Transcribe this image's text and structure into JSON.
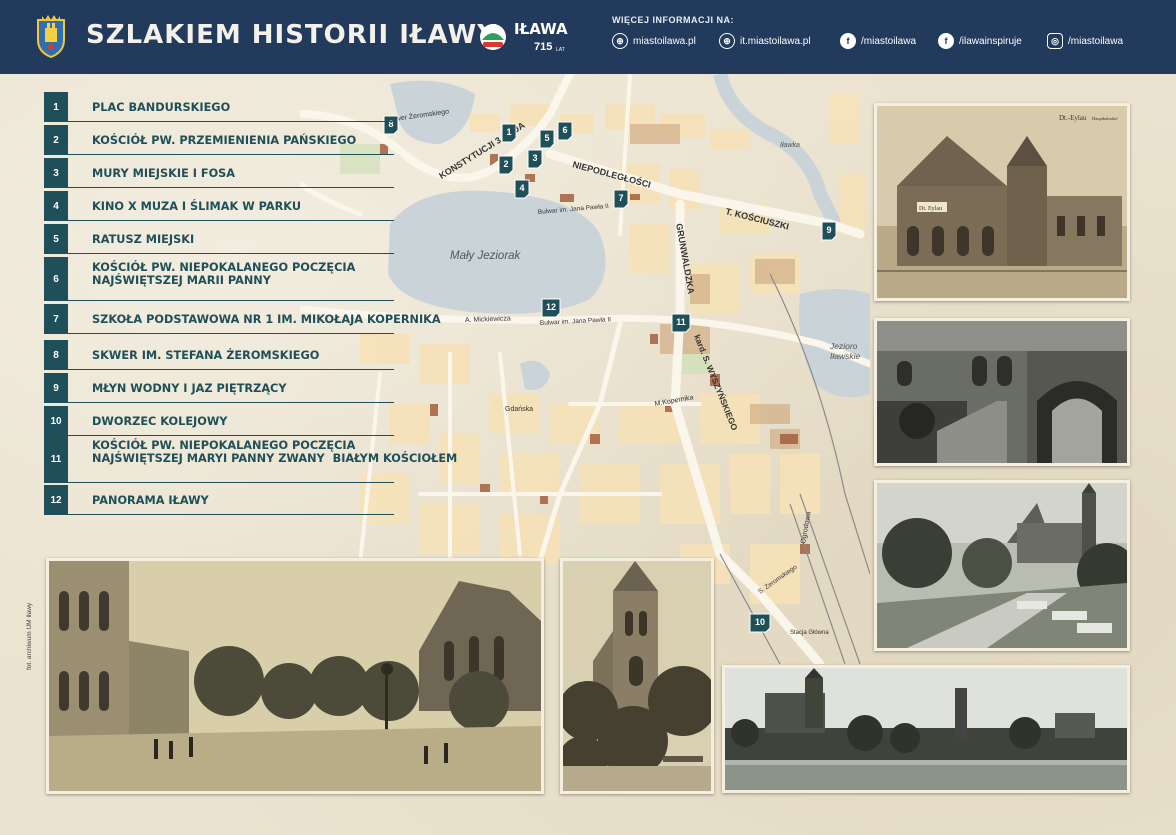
{
  "header": {
    "title": "SZLAKIEM HISTORII IŁAWY",
    "logo_text": "IŁAWA",
    "logo_years": "715",
    "logo_years_suffix": "LAT",
    "info_label": "WIĘCEJ INFORMACJI NA:",
    "links": [
      {
        "icon": "globe-icon",
        "text": "miastoilawa.pl"
      },
      {
        "icon": "globe-icon",
        "text": "it.miastoilawa.pl"
      },
      {
        "icon": "facebook-icon",
        "text": "/miastoilawa"
      },
      {
        "icon": "facebook-icon",
        "text": "/ilawainspiruje"
      },
      {
        "icon": "instagram-icon",
        "text": "/miastoilawa"
      }
    ]
  },
  "legend": [
    {
      "num": "1",
      "label": "PLAC BANDURSKIEGO"
    },
    {
      "num": "2",
      "label": "KOŚCIÓŁ PW. PRZEMIENIENIA PAŃSKIEGO"
    },
    {
      "num": "3",
      "label": "MURY MIEJSKIE I FOSA"
    },
    {
      "num": "4",
      "label": "KINO X MUZA I ŚLIMAK W PARKU"
    },
    {
      "num": "5",
      "label": "RATUSZ MIEJSKI"
    },
    {
      "num": "6",
      "label": "KOŚCIÓŁ PW. NIEPOKALANEGO POCZĘCIA\nNAJŚWIĘTSZEJ MARII PANNY"
    },
    {
      "num": "7",
      "label": "SZKOŁA PODSTAWOWA NR 1 IM. MIKOŁAJA KOPERNIKA"
    },
    {
      "num": "8",
      "label": "SKWER IM. STEFANA ŻEROMSKIEGO"
    },
    {
      "num": "9",
      "label": "MŁYN WODNY I JAZ PIĘTRZĄCY"
    },
    {
      "num": "10",
      "label": "DWORZEC KOLEJOWY"
    },
    {
      "num": "11",
      "label": "KOŚCIÓŁ PW. NIEPOKALANEGO POCZĘCIA\nNAJŚWIĘTSZEJ MARYI PANNY ZWANY  BIAŁYM KOŚCIOŁEM"
    },
    {
      "num": "12",
      "label": "PANORAMA IŁAWY"
    }
  ],
  "map": {
    "lake_small": "Mały  Jeziorak",
    "lake_ilawskie": "Jezioro\nIławskie",
    "river": "Iławka",
    "streets": {
      "konstytucji": "KONSTYTUCJI 3 MAJA",
      "niepodleglosci": "NIEPODLEGŁOŚCI",
      "kosciuszki": "T. KOŚCIUSZKI",
      "grunwaldzka": "GRUNWALDZKA",
      "wyszynskiego": "kard. S. WYSZYŃSKIEGO",
      "zeromskiego": "Skwer Żeromskiego",
      "bulwar1": "Bulwar im. Jana Pawła II",
      "bulwar2": "Bulwar im. Jana Pawła II",
      "mickiewicza": "A. Mickiewicza",
      "kopernika": "M.Kopernika",
      "gdanska": "Gdańska",
      "ogrodowa": "Ogrodowa",
      "zeromskiego_st": "S. Żeromskiego",
      "dworzec": "Stacja Główna"
    },
    "markers": [
      {
        "num": "1"
      },
      {
        "num": "2"
      },
      {
        "num": "3"
      },
      {
        "num": "4"
      },
      {
        "num": "5"
      },
      {
        "num": "6"
      },
      {
        "num": "7"
      },
      {
        "num": "8"
      },
      {
        "num": "9"
      },
      {
        "num": "10"
      },
      {
        "num": "11"
      },
      {
        "num": "12"
      }
    ]
  },
  "photos": {
    "station_caption": "Dt.-Eylau",
    "station_caption_right": "Hauptbahnhof",
    "station_sign": "Dt. Eylau",
    "credit": "fot. archiwum UM Iławy"
  },
  "colors": {
    "header_bg": "#223a5b",
    "accent": "#1f4f58",
    "marker": "#1f4f58"
  }
}
